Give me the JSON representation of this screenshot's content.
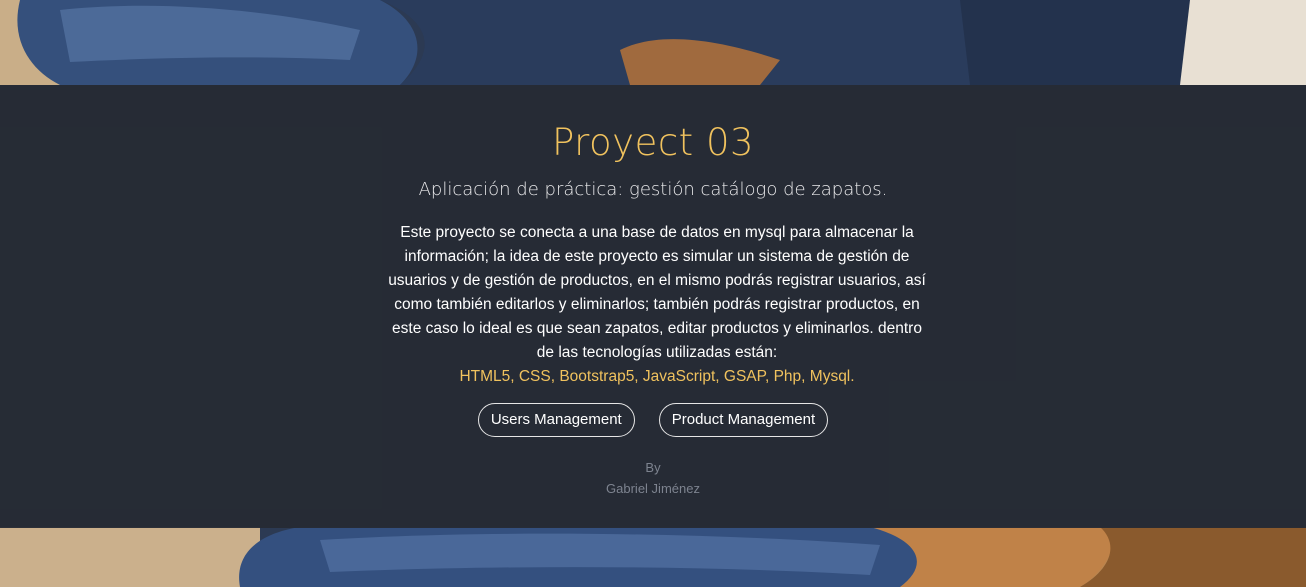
{
  "hero": {
    "title": "Proyect 03",
    "subtitle": "Aplicación de práctica: gestión catálogo de zapatos.",
    "description": "Este proyecto se conecta a una base de datos en mysql para almacenar la información; la idea de este proyecto es simular un sistema de gestión de usuarios y de gestión de productos, en el mismo podrás registrar usuarios, así como también editarlos y eliminarlos; también podrás registrar productos, en este caso lo ideal es que sean zapatos, editar productos y eliminarlos. dentro de las tecnologías utilizadas están:",
    "technologies": "HTML5, CSS, Bootstrap5, JavaScript, GSAP, Php, Mysql."
  },
  "buttons": {
    "users": "Users Management",
    "products": "Product Management"
  },
  "credit": {
    "by": "By",
    "author": "Gabriel Jiménez"
  },
  "colors": {
    "accent": "#f0c25e",
    "overlay": "#262b34",
    "muted_text": "#7d838f"
  },
  "background": {
    "image": "shoes-photo"
  }
}
